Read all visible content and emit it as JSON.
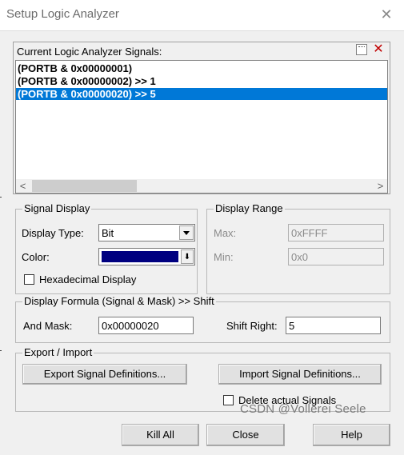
{
  "window": {
    "title": "Setup Logic Analyzer",
    "close_glyph": "✕"
  },
  "signals": {
    "label": "Current Logic Analyzer Signals:",
    "items": [
      "(PORTB & 0x00000001)",
      "(PORTB & 0x00000002) >> 1",
      "(PORTB & 0x00000020) >> 5"
    ],
    "selected_index": 2,
    "new_icon": "new-signal-icon",
    "delete_icon": "delete-signal-icon",
    "delete_glyph": "✕",
    "scroll_left": "<",
    "scroll_right": ">"
  },
  "signal_display": {
    "title": "Signal Display",
    "type_label": "Display Type:",
    "type_value": "Bit",
    "color_label": "Color:",
    "color_value": "#000080",
    "color_btn_glyph": "⬇",
    "hex_label": "Hexadecimal Display",
    "hex_checked": false
  },
  "display_range": {
    "title": "Display Range",
    "max_label": "Max:",
    "max_value": "0xFFFF",
    "min_label": "Min:",
    "min_value": "0x0"
  },
  "formula": {
    "title": "Display Formula (Signal & Mask) >> Shift",
    "mask_label": "And Mask:",
    "mask_value": "0x00000020",
    "shift_label": "Shift Right:",
    "shift_value": "5"
  },
  "export_import": {
    "title": "Export / Import",
    "export_label": "Export Signal Definitions...",
    "import_label": "Import Signal Definitions...",
    "delete_label": "Delete actual Signals",
    "delete_checked": false
  },
  "buttons": {
    "kill_all": "Kill All",
    "close": "Close",
    "help": "Help"
  },
  "watermark": "CSDN @Vollerei Seele",
  "colors": {
    "selection": "#0078d7",
    "dialog_bg": "#f0f0f0"
  }
}
